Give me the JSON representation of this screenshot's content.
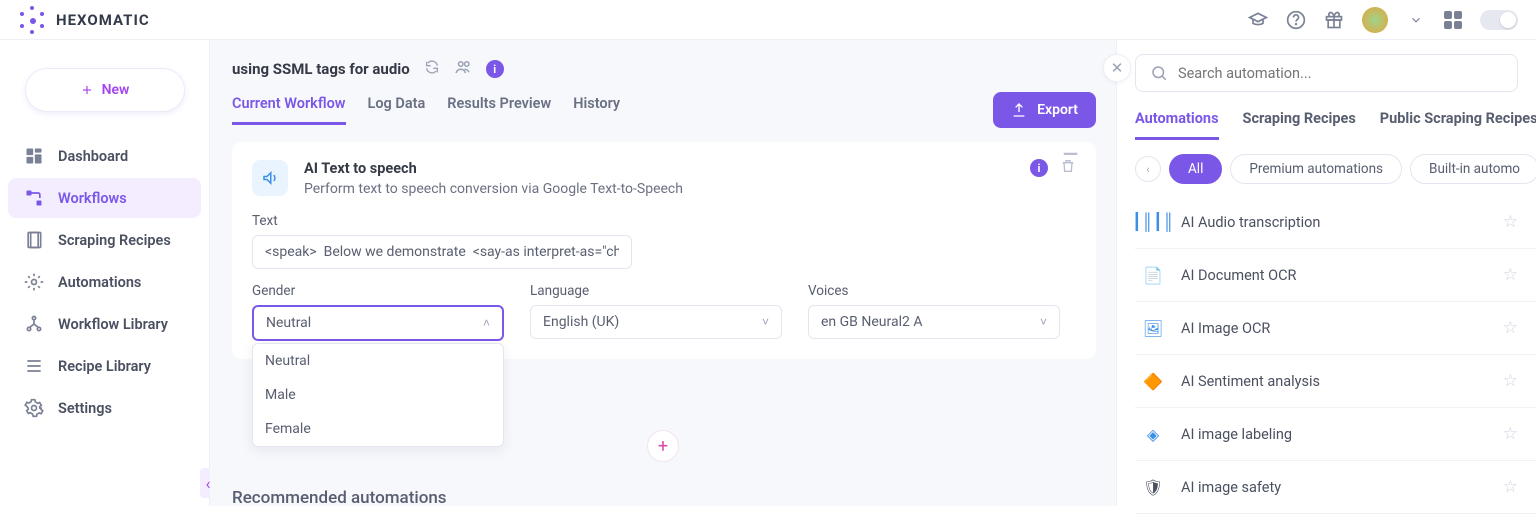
{
  "brand": "HEXOMATIC",
  "newButton": "New",
  "sidebar": {
    "items": [
      {
        "label": "Dashboard"
      },
      {
        "label": "Workflows"
      },
      {
        "label": "Scraping Recipes"
      },
      {
        "label": "Automations"
      },
      {
        "label": "Workflow Library"
      },
      {
        "label": "Recipe Library"
      },
      {
        "label": "Settings"
      }
    ]
  },
  "workflow": {
    "title": "using SSML tags for audio",
    "tabs": [
      "Current Workflow",
      "Log Data",
      "Results Preview",
      "History"
    ],
    "exportLabel": "Export"
  },
  "step": {
    "title": "AI Text to speech",
    "desc": "Perform text to speech conversion via Google Text-to-Speech",
    "textLabel": "Text",
    "textValue": "<speak>  Below we demonstrate  <say-as interpret-as=\"ch",
    "genderLabel": "Gender",
    "genderValue": "Neutral",
    "genderOptions": [
      "Neutral",
      "Male",
      "Female"
    ],
    "languageLabel": "Language",
    "languageValue": "English (UK)",
    "voicesLabel": "Voices",
    "voicesValue": "en GB Neural2 A"
  },
  "recommendedHeader": "Recommended automations",
  "panel": {
    "searchPlaceholder": "Search automation...",
    "tabs": [
      "Automations",
      "Scraping Recipes",
      "Public Scraping Recipes"
    ],
    "pills": [
      "All",
      "Premium automations",
      "Built-in automo"
    ],
    "items": [
      {
        "name": "AI Audio transcription"
      },
      {
        "name": "AI Document OCR"
      },
      {
        "name": "AI Image OCR"
      },
      {
        "name": "AI Sentiment analysis"
      },
      {
        "name": "AI image labeling"
      },
      {
        "name": "AI image safety"
      }
    ]
  }
}
